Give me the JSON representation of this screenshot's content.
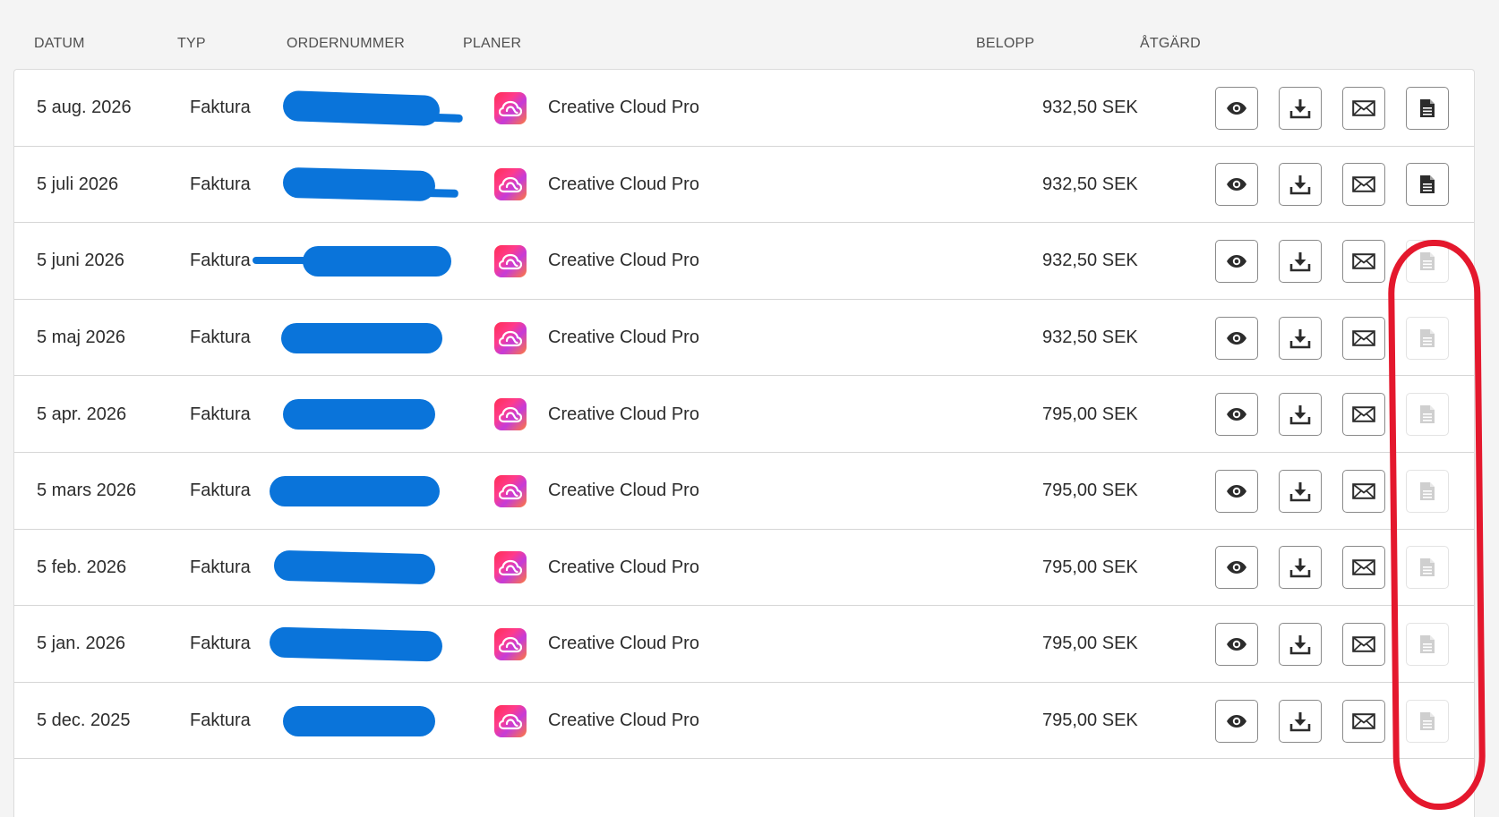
{
  "columns": {
    "date": "DATUM",
    "type": "TYP",
    "order": "ORDERNUMMER",
    "plan": "PLANER",
    "amount": "BELOPP",
    "action": "ÅTGÄRD"
  },
  "rows": [
    {
      "date": "5 aug. 2026",
      "type": "Faktura",
      "plan": "Creative Cloud Pro",
      "amount": "932,50 SEK",
      "receipt_enabled": true
    },
    {
      "date": "5 juli 2026",
      "type": "Faktura",
      "plan": "Creative Cloud Pro",
      "amount": "932,50 SEK",
      "receipt_enabled": true
    },
    {
      "date": "5 juni 2026",
      "type": "Faktura",
      "plan": "Creative Cloud Pro",
      "amount": "932,50 SEK",
      "receipt_enabled": false
    },
    {
      "date": "5 maj 2026",
      "type": "Faktura",
      "plan": "Creative Cloud Pro",
      "amount": "932,50 SEK",
      "receipt_enabled": false
    },
    {
      "date": "5 apr. 2026",
      "type": "Faktura",
      "plan": "Creative Cloud Pro",
      "amount": "795,00 SEK",
      "receipt_enabled": false
    },
    {
      "date": "5 mars 2026",
      "type": "Faktura",
      "plan": "Creative Cloud Pro",
      "amount": "795,00 SEK",
      "receipt_enabled": false
    },
    {
      "date": "5 feb. 2026",
      "type": "Faktura",
      "plan": "Creative Cloud Pro",
      "amount": "795,00 SEK",
      "receipt_enabled": false
    },
    {
      "date": "5 jan. 2026",
      "type": "Faktura",
      "plan": "Creative Cloud Pro",
      "amount": "795,00 SEK",
      "receipt_enabled": false
    },
    {
      "date": "5 dec. 2025",
      "type": "Faktura",
      "plan": "Creative Cloud Pro",
      "amount": "795,00 SEK",
      "receipt_enabled": false
    }
  ],
  "icons": {
    "plan": "creative-cloud-icon",
    "view": "eye-icon",
    "download": "download-icon",
    "email": "envelope-icon",
    "receipt": "document-icon"
  },
  "colors": {
    "redaction": "#0a74da",
    "annotation": "#e4182d"
  }
}
